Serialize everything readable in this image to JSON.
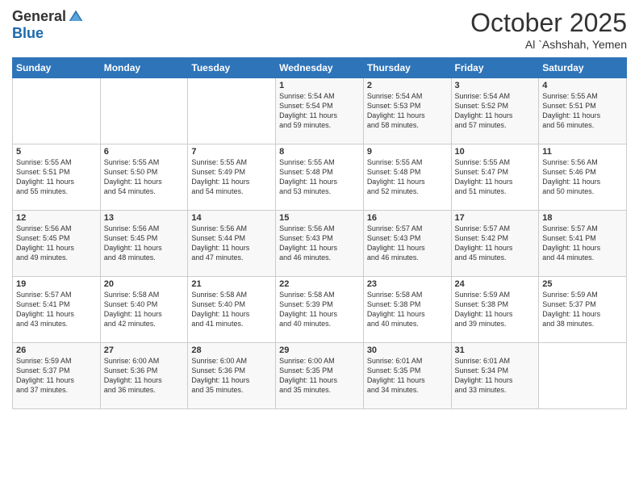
{
  "logo": {
    "general": "General",
    "blue": "Blue"
  },
  "title": "October 2025",
  "location": "Al `Ashshah, Yemen",
  "days_header": [
    "Sunday",
    "Monday",
    "Tuesday",
    "Wednesday",
    "Thursday",
    "Friday",
    "Saturday"
  ],
  "weeks": [
    [
      {
        "day": "",
        "info": ""
      },
      {
        "day": "",
        "info": ""
      },
      {
        "day": "",
        "info": ""
      },
      {
        "day": "1",
        "info": "Sunrise: 5:54 AM\nSunset: 5:54 PM\nDaylight: 11 hours\nand 59 minutes."
      },
      {
        "day": "2",
        "info": "Sunrise: 5:54 AM\nSunset: 5:53 PM\nDaylight: 11 hours\nand 58 minutes."
      },
      {
        "day": "3",
        "info": "Sunrise: 5:54 AM\nSunset: 5:52 PM\nDaylight: 11 hours\nand 57 minutes."
      },
      {
        "day": "4",
        "info": "Sunrise: 5:55 AM\nSunset: 5:51 PM\nDaylight: 11 hours\nand 56 minutes."
      }
    ],
    [
      {
        "day": "5",
        "info": "Sunrise: 5:55 AM\nSunset: 5:51 PM\nDaylight: 11 hours\nand 55 minutes."
      },
      {
        "day": "6",
        "info": "Sunrise: 5:55 AM\nSunset: 5:50 PM\nDaylight: 11 hours\nand 54 minutes."
      },
      {
        "day": "7",
        "info": "Sunrise: 5:55 AM\nSunset: 5:49 PM\nDaylight: 11 hours\nand 54 minutes."
      },
      {
        "day": "8",
        "info": "Sunrise: 5:55 AM\nSunset: 5:48 PM\nDaylight: 11 hours\nand 53 minutes."
      },
      {
        "day": "9",
        "info": "Sunrise: 5:55 AM\nSunset: 5:48 PM\nDaylight: 11 hours\nand 52 minutes."
      },
      {
        "day": "10",
        "info": "Sunrise: 5:55 AM\nSunset: 5:47 PM\nDaylight: 11 hours\nand 51 minutes."
      },
      {
        "day": "11",
        "info": "Sunrise: 5:56 AM\nSunset: 5:46 PM\nDaylight: 11 hours\nand 50 minutes."
      }
    ],
    [
      {
        "day": "12",
        "info": "Sunrise: 5:56 AM\nSunset: 5:45 PM\nDaylight: 11 hours\nand 49 minutes."
      },
      {
        "day": "13",
        "info": "Sunrise: 5:56 AM\nSunset: 5:45 PM\nDaylight: 11 hours\nand 48 minutes."
      },
      {
        "day": "14",
        "info": "Sunrise: 5:56 AM\nSunset: 5:44 PM\nDaylight: 11 hours\nand 47 minutes."
      },
      {
        "day": "15",
        "info": "Sunrise: 5:56 AM\nSunset: 5:43 PM\nDaylight: 11 hours\nand 46 minutes."
      },
      {
        "day": "16",
        "info": "Sunrise: 5:57 AM\nSunset: 5:43 PM\nDaylight: 11 hours\nand 46 minutes."
      },
      {
        "day": "17",
        "info": "Sunrise: 5:57 AM\nSunset: 5:42 PM\nDaylight: 11 hours\nand 45 minutes."
      },
      {
        "day": "18",
        "info": "Sunrise: 5:57 AM\nSunset: 5:41 PM\nDaylight: 11 hours\nand 44 minutes."
      }
    ],
    [
      {
        "day": "19",
        "info": "Sunrise: 5:57 AM\nSunset: 5:41 PM\nDaylight: 11 hours\nand 43 minutes."
      },
      {
        "day": "20",
        "info": "Sunrise: 5:58 AM\nSunset: 5:40 PM\nDaylight: 11 hours\nand 42 minutes."
      },
      {
        "day": "21",
        "info": "Sunrise: 5:58 AM\nSunset: 5:40 PM\nDaylight: 11 hours\nand 41 minutes."
      },
      {
        "day": "22",
        "info": "Sunrise: 5:58 AM\nSunset: 5:39 PM\nDaylight: 11 hours\nand 40 minutes."
      },
      {
        "day": "23",
        "info": "Sunrise: 5:58 AM\nSunset: 5:38 PM\nDaylight: 11 hours\nand 40 minutes."
      },
      {
        "day": "24",
        "info": "Sunrise: 5:59 AM\nSunset: 5:38 PM\nDaylight: 11 hours\nand 39 minutes."
      },
      {
        "day": "25",
        "info": "Sunrise: 5:59 AM\nSunset: 5:37 PM\nDaylight: 11 hours\nand 38 minutes."
      }
    ],
    [
      {
        "day": "26",
        "info": "Sunrise: 5:59 AM\nSunset: 5:37 PM\nDaylight: 11 hours\nand 37 minutes."
      },
      {
        "day": "27",
        "info": "Sunrise: 6:00 AM\nSunset: 5:36 PM\nDaylight: 11 hours\nand 36 minutes."
      },
      {
        "day": "28",
        "info": "Sunrise: 6:00 AM\nSunset: 5:36 PM\nDaylight: 11 hours\nand 35 minutes."
      },
      {
        "day": "29",
        "info": "Sunrise: 6:00 AM\nSunset: 5:35 PM\nDaylight: 11 hours\nand 35 minutes."
      },
      {
        "day": "30",
        "info": "Sunrise: 6:01 AM\nSunset: 5:35 PM\nDaylight: 11 hours\nand 34 minutes."
      },
      {
        "day": "31",
        "info": "Sunrise: 6:01 AM\nSunset: 5:34 PM\nDaylight: 11 hours\nand 33 minutes."
      },
      {
        "day": "",
        "info": ""
      }
    ]
  ]
}
